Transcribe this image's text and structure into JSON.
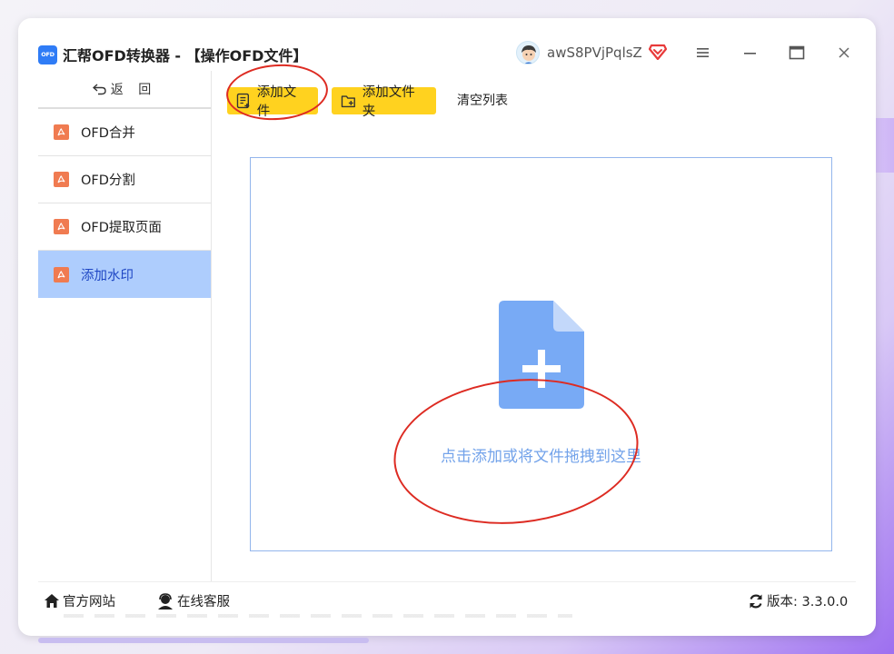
{
  "window": {
    "app_logo": "OFD",
    "title": "汇帮OFD转换器 - 【操作OFD文件】",
    "username": "awS8PVjPqlsZ"
  },
  "sidebar": {
    "back_label": "返 回",
    "items": [
      {
        "label": "OFD合并",
        "active": false
      },
      {
        "label": "OFD分割",
        "active": false
      },
      {
        "label": "OFD提取页面",
        "active": false
      },
      {
        "label": "添加水印",
        "active": true
      }
    ]
  },
  "toolbar": {
    "add_file": "添加文件",
    "add_folder": "添加文件夹",
    "clear_list": "清空列表"
  },
  "dropzone": {
    "hint": "点击添加或将文件拖拽到这里"
  },
  "footer": {
    "website": "官方网站",
    "service": "在线客服",
    "version": "版本: 3.3.0.0"
  },
  "colors": {
    "accent": "#ffd21f",
    "active_bg": "#aecdfd",
    "pdf_icon": "#f07b51",
    "doc_icon": "#78aaf5",
    "annotation": "#dd2b22"
  }
}
